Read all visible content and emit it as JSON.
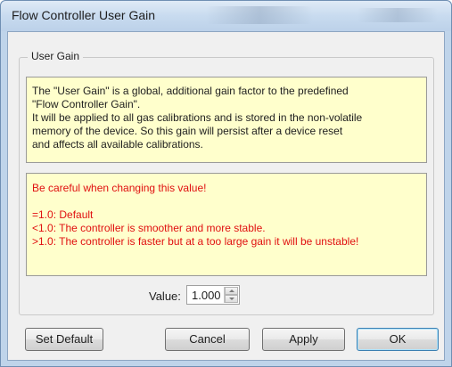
{
  "window": {
    "title": "Flow Controller User Gain"
  },
  "group": {
    "label": "User Gain"
  },
  "info": {
    "lines": [
      "The \"User Gain\" is a global, additional gain factor to the predefined",
      "\"Flow Controller Gain\".",
      "It will be applied to all gas calibrations and is stored in the non-volatile",
      "memory of the device. So this gain will persist after a device reset",
      "and affects all available calibrations."
    ]
  },
  "warning": {
    "heading": "Be careful when changing this value!",
    "lines": [
      "=1.0: Default",
      "<1.0: The controller is smoother and more stable.",
      ">1.0: The controller is faster but at a too large gain it will be unstable!"
    ]
  },
  "value": {
    "label": "Value:",
    "current": "1.000"
  },
  "buttons": {
    "set_default": "Set Default",
    "cancel": "Cancel",
    "apply": "Apply",
    "ok": "OK"
  },
  "colors": {
    "note_background": "#ffffcc",
    "warning_text": "#e01010",
    "titlebar": "#c8dbef"
  }
}
